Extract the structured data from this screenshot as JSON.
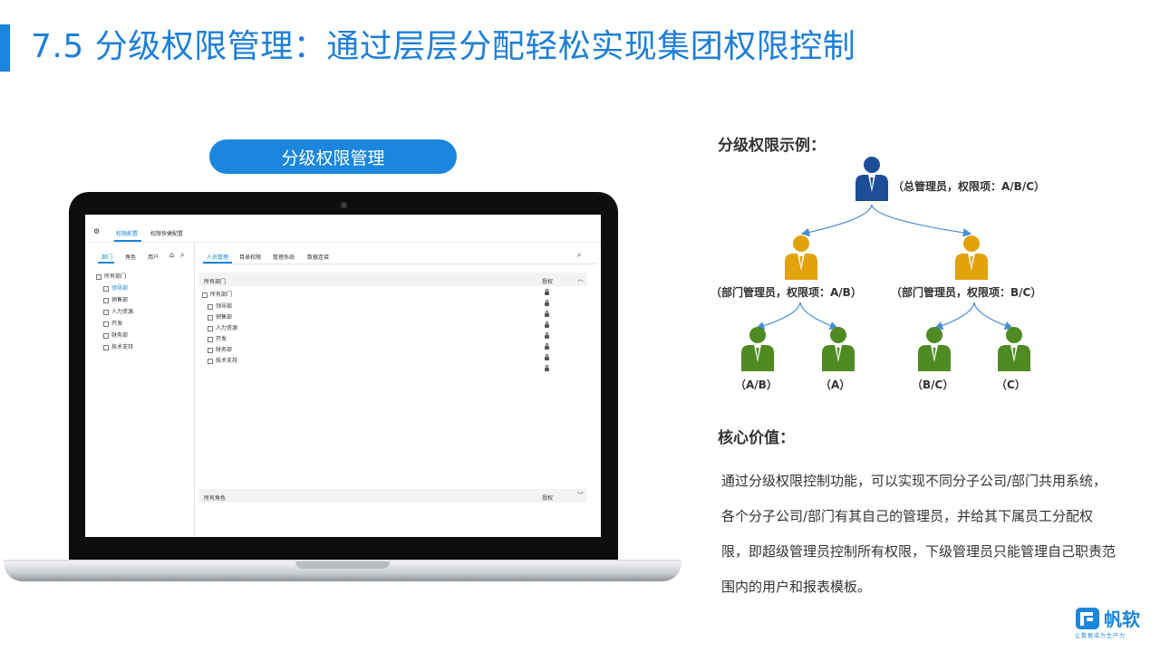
{
  "slide": {
    "title": "7.5 分级权限管理：通过层层分配轻松实现集团权限控制",
    "pill_label": "分级权限管理",
    "accent_color": "#1b86dd"
  },
  "screen": {
    "top_tabs": [
      "权限配置",
      "权限快捷配置"
    ],
    "left_tabs": [
      "部门",
      "角色",
      "用户"
    ],
    "tree_root": "所有部门",
    "tree_items": [
      "领导部",
      "销售部",
      "人力资源",
      "开发",
      "财务部",
      "技术支持"
    ],
    "right_tabs": [
      "人员管理",
      "目录权限",
      "管理系统",
      "数据连接"
    ],
    "panel_header": "所有部门",
    "auth_label": "授权",
    "panel_root": "所有部门",
    "panel_items": [
      "领导部",
      "销售部",
      "人力资源",
      "开发",
      "财务部",
      "技术支持"
    ],
    "bottom_header": "所有角色",
    "bottom_auth": "授权"
  },
  "example": {
    "heading": "分级权限示例：",
    "top_label": "（总管理员，权限项：A/B/C）",
    "mid_left_label": "（部门管理员，权限项：A/B）",
    "mid_right_label": "（部门管理员，权限项：B/C）",
    "leaf_labels": [
      "（A/B）",
      "（A）",
      "（B/C）",
      "（C）"
    ],
    "colors": {
      "top": "#1f4e99",
      "mid": "#e1a20c",
      "leaf": "#4f8a23",
      "arrow": "#4a8fd4"
    }
  },
  "value": {
    "heading": "核心价值：",
    "text": "通过分级权限控制功能，可以实现不同分子公司/部门共用系统，各个分子公司/部门有其自己的管理员，并给其下属员工分配权限，即超级管理员控制所有权限，下级管理员只能管理自己职责范围内的用户和报表模板。"
  },
  "logo": {
    "text": "帆软",
    "slogan": "让数据成为生产力",
    "icon": "fanruan-logo-icon"
  }
}
